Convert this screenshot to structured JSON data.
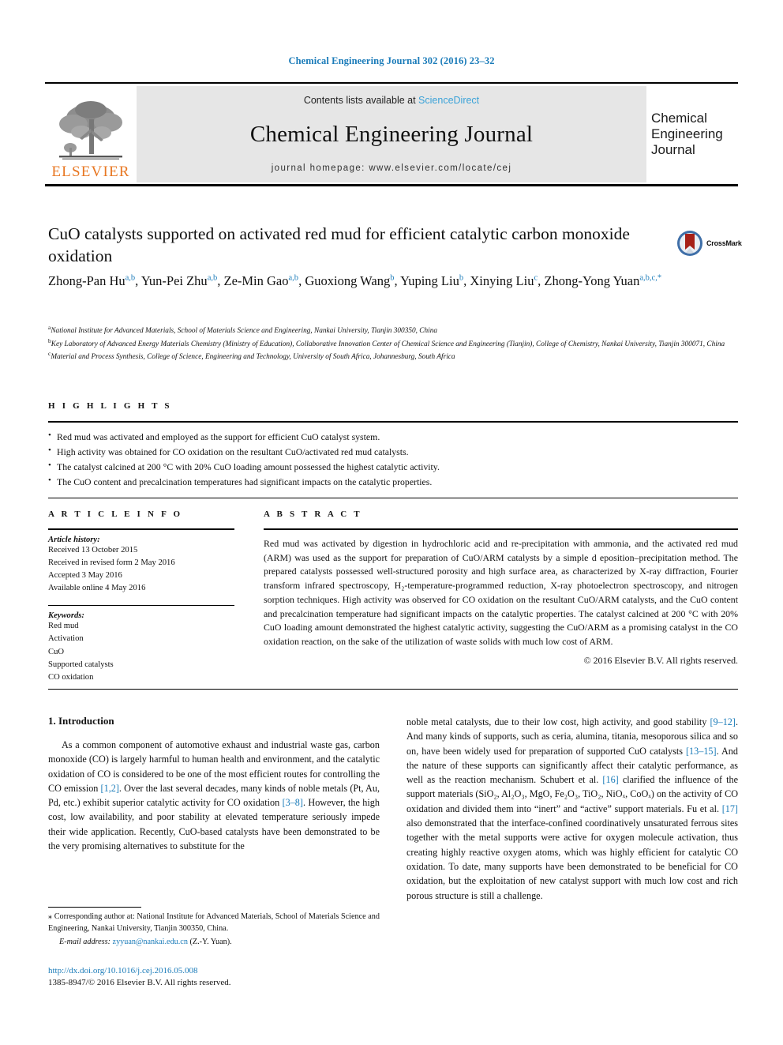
{
  "running_head": "Chemical Engineering Journal 302 (2016) 23–32",
  "masthead": {
    "contents_prefix": "Contents lists available at ",
    "sciencedirect": "ScienceDirect",
    "journal_title": "Chemical Engineering Journal",
    "homepage": "journal homepage: www.elsevier.com/locate/cej",
    "publisher_logo_text": "ELSEVIER",
    "cover_line_1": "Chemical",
    "cover_line_2": "Engineering",
    "cover_line_3": "Journal",
    "link_color": "#3aa2d8",
    "band_color": "#e6e6e6",
    "elsevier_orange": "#e87722"
  },
  "article": {
    "title": "CuO catalysts supported on activated red mud for efficient catalytic carbon monoxide oxidation",
    "crossmark_label": "CrossMark",
    "authors": [
      {
        "name": "Zhong-Pan Hu",
        "sup": "a,b",
        "sep": ", "
      },
      {
        "name": "Yun-Pei Zhu",
        "sup": "a,b",
        "sep": ", "
      },
      {
        "name": "Ze-Min Gao",
        "sup": "a,b",
        "sep": ", "
      },
      {
        "name": "Guoxiong Wang",
        "sup": "b",
        "sep": ", "
      },
      {
        "name": "Yuping Liu",
        "sup": "b",
        "sep": ", "
      },
      {
        "name": "Xinying Liu",
        "sup": "c",
        "sep": ", "
      },
      {
        "name": "Zhong-Yong Yuan",
        "sup": "a,b,c,*",
        "sep": ""
      }
    ],
    "affiliations": [
      {
        "mark": "a",
        "text": "National Institute for Advanced Materials, School of Materials Science and Engineering, Nankai University, Tianjin 300350, China"
      },
      {
        "mark": "b",
        "text": "Key Laboratory of Advanced Energy Materials Chemistry (Ministry of Education), Collaborative Innovation Center of Chemical Science and Engineering (Tianjin), College of Chemistry, Nankai University, Tianjin 300071, China"
      },
      {
        "mark": "c",
        "text": "Material and Process Synthesis, College of Science, Engineering and Technology, University of South Africa, Johannesburg, South Africa"
      }
    ]
  },
  "highlights": {
    "label": "H I G H L I G H T S",
    "items": [
      "Red mud was activated and employed as the support for efficient CuO catalyst system.",
      "High activity was obtained for CO oxidation on the resultant CuO/activated red mud catalysts.",
      "The catalyst calcined at 200 °C with 20% CuO loading amount possessed the highest catalytic activity.",
      "The CuO content and precalcination temperatures had significant impacts on the catalytic properties."
    ]
  },
  "article_info": {
    "label": "A R T I C L E    I N F O",
    "history_label": "Article history:",
    "history": [
      "Received 13 October 2015",
      "Received in revised form 2 May 2016",
      "Accepted 3 May 2016",
      "Available online 4 May 2016"
    ],
    "keywords_label": "Keywords:",
    "keywords": [
      "Red mud",
      "Activation",
      "CuO",
      "Supported catalysts",
      "CO oxidation"
    ]
  },
  "abstract": {
    "label": "A B S T R A C T",
    "text": "Red mud was activated by digestion in hydrochloric acid and re-precipitation with ammonia, and the activated red mud (ARM) was used as the support for preparation of CuO/ARM catalysts by a simple d eposition–precipitation method. The prepared catalysts possessed well-structured porosity and high surface area, as characterized by X-ray diffraction, Fourier transform infrared spectroscopy, H₂-temperature-programmed reduction, X-ray photoelectron spectroscopy, and nitrogen sorption techniques. High activity was observed for CO oxidation on the resultant CuO/ARM catalysts, and the CuO content and precalcination temperature had significant impacts on the catalytic properties. The catalyst calcined at 200 °C with 20% CuO loading amount demonstrated the highest catalytic activity, suggesting the CuO/ARM as a promising catalyst in the CO oxidation reaction, on the sake of the utilization of waste solids with much low cost of ARM.",
    "copyright": "© 2016 Elsevier B.V. All rights reserved."
  },
  "introduction": {
    "heading": "1. Introduction",
    "left_paragraph_parts": [
      {
        "type": "text",
        "value": "As a common component of automotive exhaust and industrial waste gas, carbon monoxide (CO) is largely harmful to human health and environment, and the catalytic oxidation of CO is considered to be one of the most efficient routes for controlling the CO emission "
      },
      {
        "type": "ref",
        "value": "[1,2]"
      },
      {
        "type": "text",
        "value": ". Over the last several decades, many kinds of noble metals (Pt, Au, Pd, etc.) exhibit superior catalytic activity for CO oxidation "
      },
      {
        "type": "ref",
        "value": "[3–8]"
      },
      {
        "type": "text",
        "value": ". However, the high cost, low availability, and poor stability at elevated temperature seriously impede their wide application. Recently, CuO-based catalysts have been demonstrated to be the very promising alternatives to substitute for the"
      }
    ],
    "right_paragraph_parts": [
      {
        "type": "text",
        "value": "noble metal catalysts, due to their low cost, high activity, and good stability "
      },
      {
        "type": "ref",
        "value": "[9–12]"
      },
      {
        "type": "text",
        "value": ". And many kinds of supports, such as ceria, alumina, titania, mesoporous silica and so on, have been widely used for preparation of supported CuO catalysts "
      },
      {
        "type": "ref",
        "value": "[13–15]"
      },
      {
        "type": "text",
        "value": ". And the nature of these supports can significantly affect their catalytic performance, as well as the reaction mechanism. Schubert et al. "
      },
      {
        "type": "ref",
        "value": "[16]"
      },
      {
        "type": "text",
        "value": " clarified the influence of the support materials (SiO₂, Al₂O₃, MgO, Fe₂O₃, TiO₂, NiOₓ, CoOₓ) on the activity of CO oxidation and divided them into “inert” and “active” support materials. Fu et al. "
      },
      {
        "type": "ref",
        "value": "[17]"
      },
      {
        "type": "text",
        "value": " also demonstrated that the interface-confined coordinatively unsaturated ferrous sites together with the metal supports were active for oxygen molecule activation, thus creating highly reactive oxygen atoms, which was highly efficient for catalytic CO oxidation. To date, many supports have been demonstrated to be beneficial for CO oxidation, but the exploitation of new catalyst support with much low cost and rich porous structure is still a challenge."
      }
    ]
  },
  "footer": {
    "corresponding_note": "⁎ Corresponding author at: National Institute for Advanced Materials, School of Materials Science and Engineering, Nankai University, Tianjin 300350, China.",
    "email_label": "E-mail address:",
    "email_address": "zyyuan@nankai.edu.cn",
    "email_suffix": " (Z.-Y. Yuan).",
    "doi": "http://dx.doi.org/10.1016/j.cej.2016.05.008",
    "issn_line": "1385-8947/© 2016 Elsevier B.V. All rights reserved.",
    "link_color": "#1a7bb9"
  }
}
